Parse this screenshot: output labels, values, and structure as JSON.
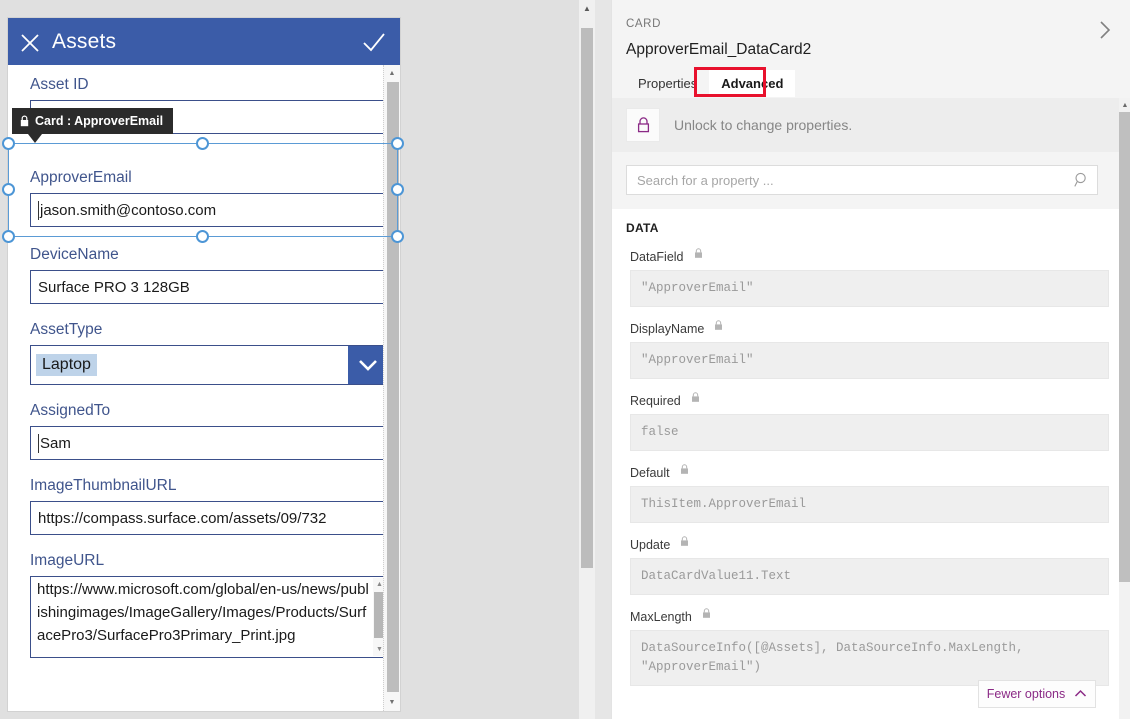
{
  "app": {
    "header": {
      "title": "Assets",
      "close_icon": "close-icon",
      "accept_icon": "checkmark-icon"
    },
    "tooltip": {
      "text": "Card : ApproverEmail",
      "lock_icon": "lock-icon"
    },
    "fields": [
      {
        "label": "Asset ID",
        "value": "",
        "type": "text"
      },
      {
        "label": "ApproverEmail",
        "value": "jason.smith@contoso.com",
        "type": "text"
      },
      {
        "label": "DeviceName",
        "value": "Surface PRO 3 128GB",
        "type": "text"
      },
      {
        "label": "AssetType",
        "value": "Laptop",
        "type": "combobox"
      },
      {
        "label": "AssignedTo",
        "value": "Sam",
        "type": "text"
      },
      {
        "label": "ImageThumbnailURL",
        "value": "https://compass.surface.com/assets/09/732",
        "type": "text"
      },
      {
        "label": "ImageURL",
        "value": "https://www.microsoft.com/global/en-us/news/publishingimages/ImageGallery/Images/Products/SurfacePro3/SurfacePro3Primary_Print.jpg",
        "type": "textarea"
      }
    ]
  },
  "panel": {
    "kicker": "CARD",
    "title": "ApproverEmail_DataCard2",
    "collapse_icon": "chevron-right-icon",
    "tabs": [
      {
        "label": "Properties",
        "active": false
      },
      {
        "label": "Advanced",
        "active": true
      }
    ],
    "highlight_color": "#e8112d",
    "lock_bar": {
      "icon": "lock-closed-icon",
      "text": "Unlock to change properties."
    },
    "search": {
      "placeholder": "Search for a property ...",
      "value": "",
      "icon": "search-icon"
    },
    "section_title": "DATA",
    "properties": [
      {
        "name": "DataField",
        "locked": true,
        "value": "\"ApproverEmail\""
      },
      {
        "name": "DisplayName",
        "locked": true,
        "value": "\"ApproverEmail\""
      },
      {
        "name": "Required",
        "locked": true,
        "value": "false"
      },
      {
        "name": "Default",
        "locked": true,
        "value": "ThisItem.ApproverEmail"
      },
      {
        "name": "Update",
        "locked": true,
        "value": "DataCardValue11.Text"
      },
      {
        "name": "MaxLength",
        "locked": true,
        "value": "DataSourceInfo([@Assets], DataSourceInfo.MaxLength, \"ApproverEmail\")"
      }
    ],
    "fewer_options": {
      "label": "Fewer options",
      "icon": "chevron-up-icon"
    }
  }
}
